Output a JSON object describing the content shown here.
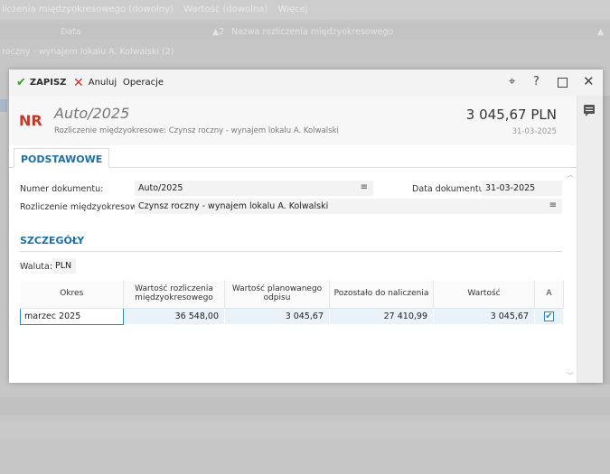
{
  "background": {
    "filter_items": [
      "liczenia międzyokresowego (dowolny)",
      "Wartość (dowolna)",
      "Więcej"
    ],
    "column_date": "Data",
    "sort_indicator": "▲2",
    "column_name": "Nazwa rozliczenia międzyokresowego",
    "column_arrow": "▲",
    "group_row": "roczny - wynajem lokalu A. Kolwalski (2)"
  },
  "toolbar": {
    "save_label": "ZAPISZ",
    "cancel_label": "Anuluj",
    "operations_label": "Operacje",
    "pin_glyph": "⌖",
    "help_glyph": "?",
    "close_glyph": "✕"
  },
  "header": {
    "badge": "NR",
    "title": "Auto/2025",
    "subtitle": "Rozliczenie międzyokresowe: Czynsz roczny - wynajem lokalu A. Kolwalski",
    "amount": "3 045,67 PLN",
    "date": "31-03-2025"
  },
  "tabs": [
    {
      "label": "PODSTAWOWE"
    }
  ],
  "form": {
    "doc_number_label": "Numer dokumentu:",
    "doc_number_value": "Auto/2025",
    "doc_date_label": "Data dokumentu:",
    "doc_date_value": "31-03-2025",
    "settlement_label": "Rozliczenie międzyokresowe:",
    "settlement_value": "Czynsz roczny - wynajem lokalu A. Kolwalski",
    "menu_glyph": "≡"
  },
  "details": {
    "section_title": "SZCZEGÓŁY",
    "currency_label": "Waluta:",
    "currency_value": "PLN",
    "columns": [
      "Okres",
      "Wartość rozliczenia międzyokresowego",
      "Wartość planowanego odpisu",
      "Pozostało do naliczenia",
      "Wartość",
      "A"
    ],
    "rows": [
      {
        "period": "marzec 2025",
        "settlement_value": "36 548,00",
        "planned_writeoff": "3 045,67",
        "remaining": "27 410,99",
        "value": "3 045,67",
        "checked": true,
        "check_glyph": "✔"
      }
    ]
  },
  "colors": {
    "accent": "#1d6fa5",
    "save_green": "#3c9a2c",
    "cancel_red": "#d42b2b",
    "badge_red": "#c0392b"
  }
}
